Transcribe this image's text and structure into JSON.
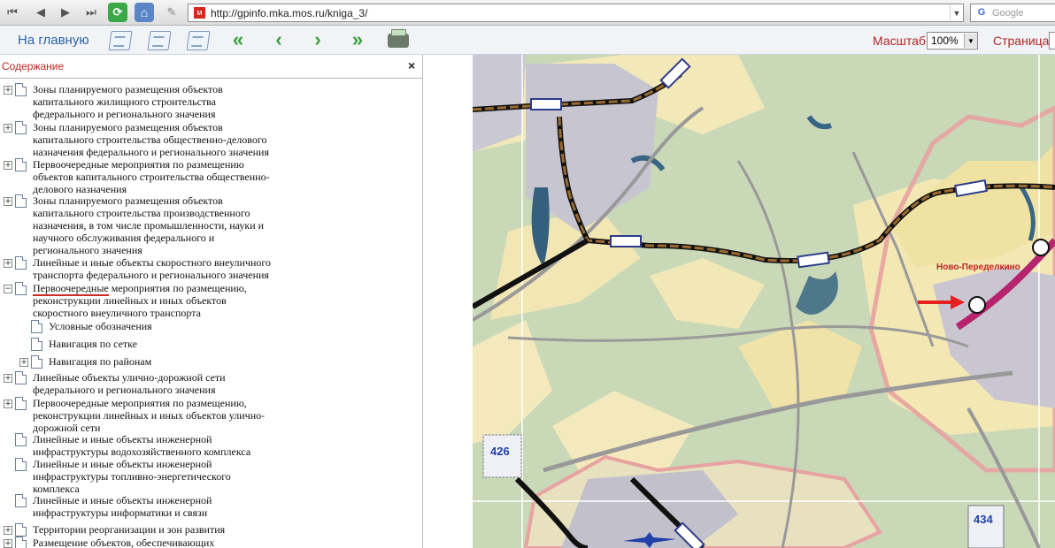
{
  "browser": {
    "url": "http://gpinfo.mka.mos.ru/kniga_3/",
    "search_placeholder": "Google",
    "icons": [
      "back-icon",
      "prev-icon",
      "forward-icon",
      "next-icon",
      "reload-icon",
      "home-icon",
      "edit-icon",
      "site-favicon",
      "google-icon"
    ]
  },
  "app": {
    "home_label": "На главную",
    "scale_label": "Масштаб",
    "scale_value": "100%",
    "page_label": "Страница",
    "colors": {
      "link": "#2b63a8",
      "label": "#b02727",
      "nav_arrows": "#37a03a"
    }
  },
  "toc": {
    "title": "Содержание",
    "close": "×",
    "items": [
      {
        "lines": [
          "Зоны планируемого размещения объектов",
          "капитального жилищного строительства",
          "федерального и регионального значения"
        ],
        "expander": "+"
      },
      {
        "lines": [
          "Зоны планируемого размещения объектов",
          "капитального строительства общественно-делового",
          "назначения федерального и регионального значения"
        ],
        "expander": "+"
      },
      {
        "lines": [
          "Первоочередные мероприятия по размещению",
          "объектов капитального строительства общественно-",
          "делового назначения"
        ],
        "expander": "+"
      },
      {
        "lines": [
          "Зоны планируемого размещения объектов",
          "капитального строительства производственного",
          "назначения, в том числе промышленности, науки и",
          "научного обслуживания федерального и",
          "регионального значения"
        ],
        "expander": "+"
      },
      {
        "lines": [
          "Линейные и иные объекты скоростного внеуличного",
          "транспорта федерального и регионального значения"
        ],
        "expander": "+"
      },
      {
        "lines": [
          "Первоочередные мероприятия по размещению,",
          "реконструкции линейных и иных объектов",
          "скоростного внеуличного транспорта"
        ],
        "expander": "−",
        "underline": "Первоочередные"
      },
      {
        "lines": [
          "Условные обозначения"
        ],
        "expander": ""
      },
      {
        "lines": [
          "Навигация по сетке"
        ],
        "expander": ""
      },
      {
        "lines": [
          "Навигация по районам"
        ],
        "expander": "+"
      },
      {
        "lines": [
          "Линейные объекты улично-дорожной сети",
          "федерального и регионального значения"
        ],
        "expander": "+"
      },
      {
        "lines": [
          "Первоочередные мероприятия по размещению,",
          "реконструкции линейных и иных объектов улично-",
          "дорожной сети"
        ],
        "expander": "+"
      },
      {
        "lines": [
          "Линейные и иные объекты инженерной",
          "инфраструктуры водохозяйственного комплекса"
        ],
        "expander": ""
      },
      {
        "lines": [
          "Линейные и иные объекты инженерной",
          "инфраструктуры топливно-энергетического",
          "комплекса"
        ],
        "expander": ""
      },
      {
        "lines": [
          "Линейные и иные объекты инженерной",
          "инфраструктуры информатики и связи"
        ],
        "expander": ""
      },
      {
        "lines": [
          "Территории реорганизации и зон развития"
        ],
        "expander": "+"
      },
      {
        "lines": [
          "Размещение объектов, обеспечивающих"
        ],
        "expander": "+"
      }
    ]
  },
  "map": {
    "place_label": "Ново-Переделкино",
    "sheet_labels": [
      "426",
      "434"
    ],
    "colors": {
      "green": "#c8d8b5",
      "yellow": "#f4eab8",
      "grey": "#c8c6cf",
      "metro": "#b7246e",
      "railway": "#8b5a2b",
      "boundary": "#e8a3a3"
    }
  }
}
